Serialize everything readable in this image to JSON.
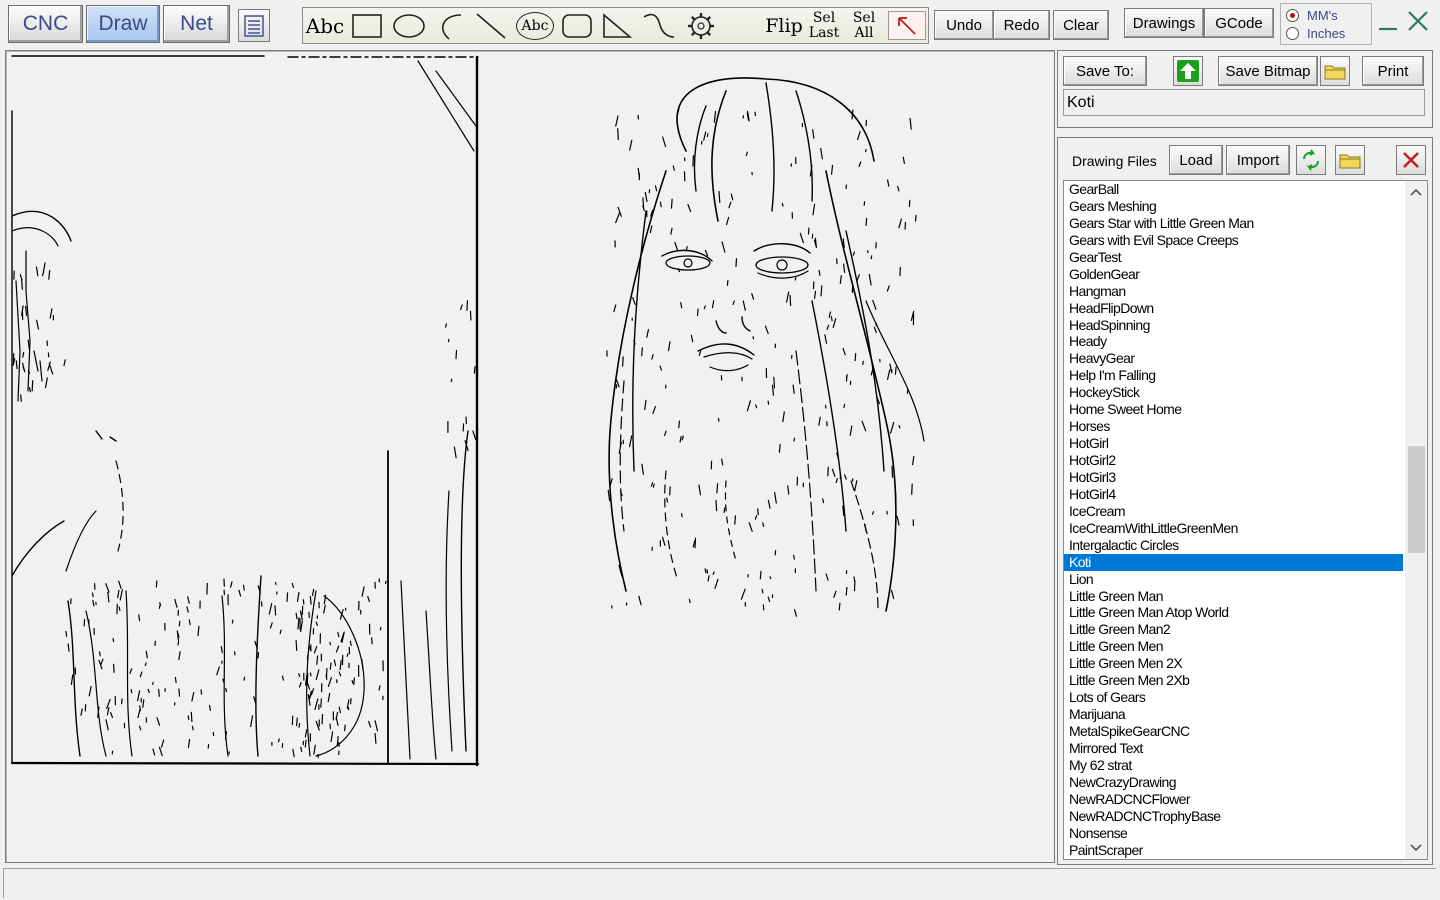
{
  "tabs": [
    {
      "label": "CNC",
      "active": false
    },
    {
      "label": "Draw",
      "active": true
    },
    {
      "label": "Net",
      "active": false
    }
  ],
  "toolbar": {
    "text_tool_label": "Abc",
    "circle_text_label": "Abc",
    "flip_label": "Flip",
    "sel_last_label": [
      "Sel",
      "Last"
    ],
    "sel_all_label": [
      "Sel",
      "All"
    ],
    "undo_label": "Undo",
    "redo_label": "Redo",
    "clear_label": "Clear",
    "drawings_label": "Drawings",
    "gcode_label": "GCode"
  },
  "units": {
    "options": [
      {
        "label": "MM's",
        "selected": true
      },
      {
        "label": "Inches",
        "selected": false
      }
    ]
  },
  "save_panel": {
    "save_to_label": "Save To:",
    "save_bitmap_label": "Save Bitmap",
    "print_label": "Print",
    "drawing_name": "Koti"
  },
  "files_panel": {
    "title": "Drawing Files",
    "load_label": "Load",
    "import_label": "Import",
    "selected": "Koti",
    "files": [
      "GearBall",
      "Gears Meshing",
      "Gears Star with Little Green Man",
      "Gears with Evil Space Creeps",
      "GearTest",
      "GoldenGear",
      "Hangman",
      "HeadFlipDown",
      "HeadSpinning",
      "Heady",
      "HeavyGear",
      "Help I'm Falling",
      "HockeyStick",
      "Home Sweet Home",
      "Horses",
      "HotGirl",
      "HotGirl2",
      "HotGirl3",
      "HotGirl4",
      "IceCream",
      "IceCreamWithLittleGreenMen",
      "Intergalactic Circles",
      "Koti",
      "Lion",
      "Little Green Man",
      "Little Green Man Atop World",
      "Little Green Man2",
      "Little Green Men",
      "Little Green Men 2X",
      "Little Green Men 2Xb",
      "Lots of Gears",
      "Marijuana",
      "MetalSpikeGearCNC",
      "Mirrored Text",
      "My 62 strat",
      "NewCrazyDrawing",
      "NewRADCNCFlower",
      "NewRADCNCTrophyBase",
      "Nonsense",
      "PaintScraper"
    ]
  },
  "colors": {
    "accent_tab": "#3a4a8c",
    "selection": "#0078d7",
    "green_icon": "#1aa01a",
    "close_red": "#c02020"
  }
}
